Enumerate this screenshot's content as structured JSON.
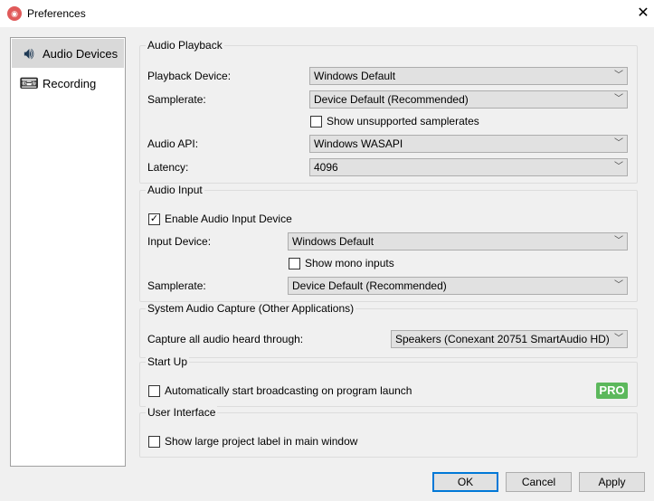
{
  "window": {
    "title": "Preferences",
    "close": "✕"
  },
  "sidebar": {
    "items": [
      {
        "label": "Audio Devices",
        "icon": "speaker-icon"
      },
      {
        "label": "Recording",
        "icon": "cassette-icon"
      }
    ]
  },
  "playback": {
    "legend": "Audio Playback",
    "device_label": "Playback Device:",
    "device_value": "Windows Default",
    "samplerate_label": "Samplerate:",
    "samplerate_value": "Device Default (Recommended)",
    "unsupported_label": "Show unsupported samplerates",
    "api_label": "Audio API:",
    "api_value": "Windows WASAPI",
    "latency_label": "Latency:",
    "latency_value": "4096"
  },
  "input": {
    "legend": "Audio Input",
    "enable_label": "Enable Audio Input Device",
    "device_label": "Input Device:",
    "device_value": "Windows Default",
    "mono_label": "Show mono inputs",
    "samplerate_label": "Samplerate:",
    "samplerate_value": "Device Default (Recommended)"
  },
  "capture": {
    "legend": "System Audio Capture (Other Applications)",
    "label": "Capture all audio heard through:",
    "value": "Speakers (Conexant 20751 SmartAudio HD)"
  },
  "startup": {
    "legend": "Start Up",
    "auto_label": "Automatically start broadcasting on program launch",
    "pro_badge": "PRO"
  },
  "ui": {
    "legend": "User Interface",
    "large_label": "Show large project label in main window"
  },
  "buttons": {
    "ok": "OK",
    "cancel": "Cancel",
    "apply": "Apply"
  },
  "check": "✓",
  "chev": "﹀"
}
